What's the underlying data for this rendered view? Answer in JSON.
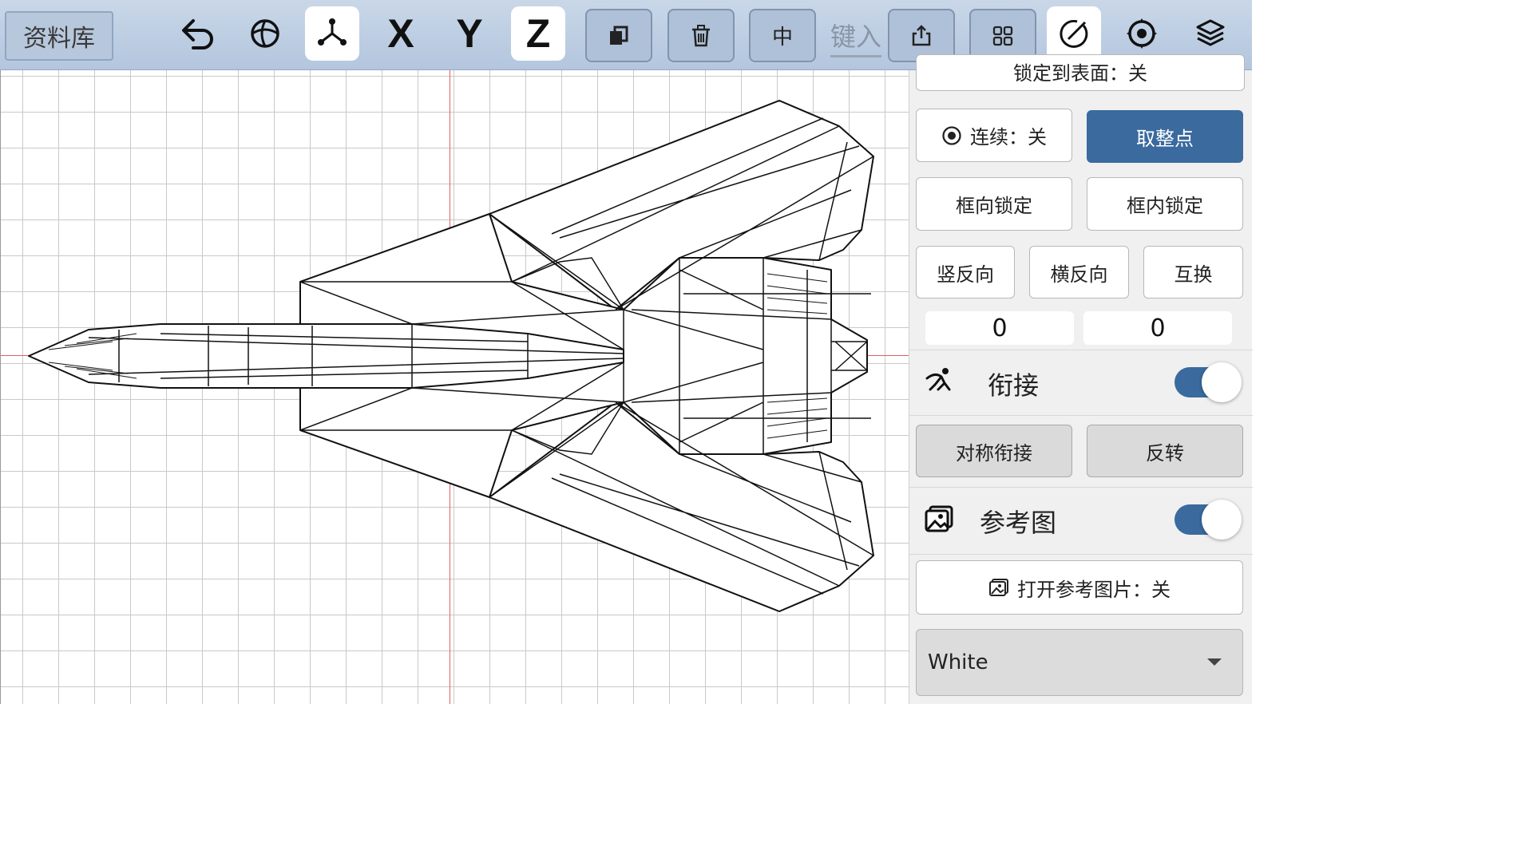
{
  "toolbar": {
    "library_label": "资料库",
    "axis_x": "X",
    "axis_y": "Y",
    "axis_z": "Z",
    "center_label": "中",
    "key_input_label": "键入",
    "icons": [
      "undo-icon",
      "sphere-icon",
      "axes-icon",
      "copy-icon",
      "trash-icon",
      "export-icon",
      "grid-icon",
      "edit-circle-icon",
      "target-icon",
      "layers-icon"
    ]
  },
  "panel": {
    "lock_surface_partial": "锁定到表面：关",
    "continuous_label": "连续：关",
    "snap_label": "取整点",
    "box_direction_lock": "框向锁定",
    "box_inner_lock": "框内锁定",
    "vertical_reverse": "竖反向",
    "horizontal_reverse": "横反向",
    "swap": "互换",
    "value_a": "0",
    "value_b": "0",
    "connect_label": "衔接",
    "connect_on": true,
    "symmetric_connect": "对称衔接",
    "reverse": "反转",
    "reference_label": "参考图",
    "reference_on": true,
    "open_reference": "打开参考图片：关",
    "color_select": "White"
  },
  "colors": {
    "accent": "#3a6a9e",
    "toolbar_bg": "#b3c6de",
    "axis_line": "#e06060"
  }
}
